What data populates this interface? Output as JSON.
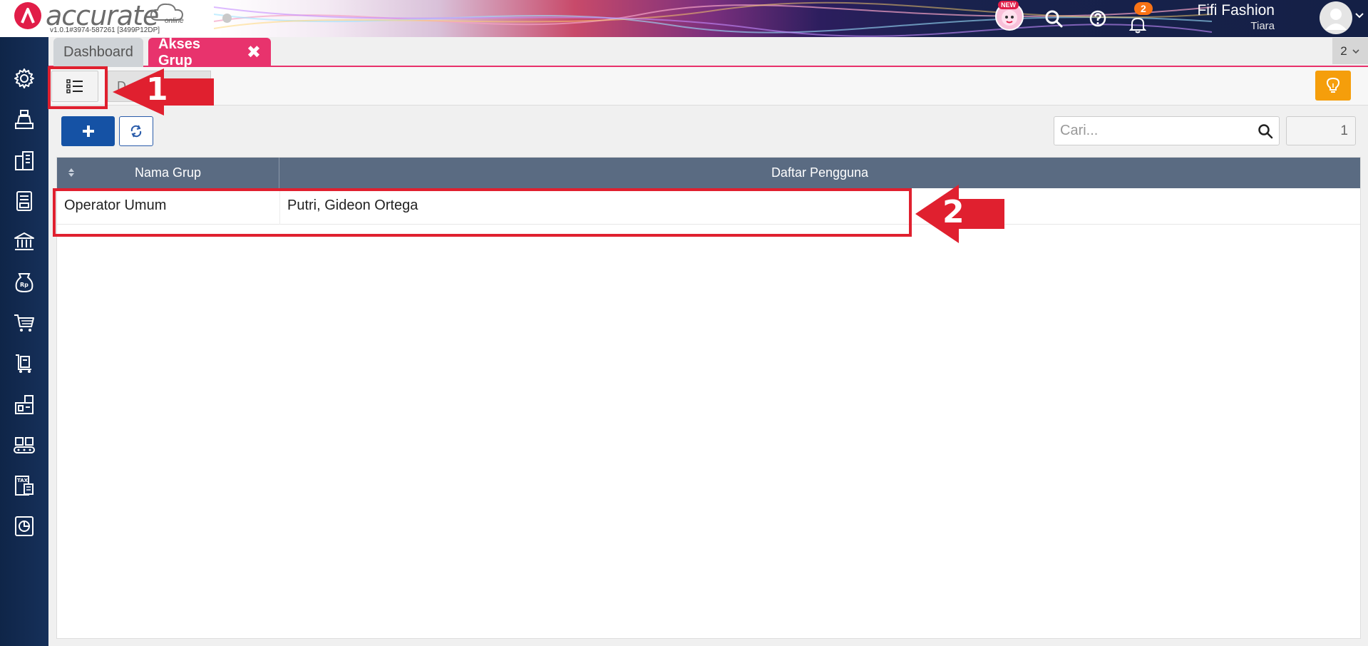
{
  "header": {
    "brand": "accurate",
    "brand_suffix": "online",
    "version": "v1.0.1#3974-587261 [3499P12DP]",
    "new_badge": "NEW",
    "notification_count": "2",
    "company": "Fifi Fashion",
    "user": "Tiara"
  },
  "tabs": [
    {
      "label": "Dashboard"
    },
    {
      "label": "Akses Grup",
      "close": "✖"
    }
  ],
  "tab_counter": "2",
  "toolbar": {
    "second_tab_label": "D"
  },
  "search": {
    "placeholder": "Cari...",
    "value": ""
  },
  "page_number": "1",
  "table": {
    "columns": [
      "Nama Grup",
      "Daftar Pengguna"
    ],
    "rows": [
      {
        "nama_grup": "Operator Umum",
        "daftar_pengguna": "Putri, Gideon Ortega"
      }
    ]
  },
  "annotations": {
    "marker_1": "1",
    "marker_2": "2",
    "color": "#e0202f"
  },
  "colors": {
    "accent_tab": "#e8336d",
    "primary_button": "#1552a5",
    "grid_header": "#5a6b82",
    "bulb_button": "#f59e0b"
  }
}
